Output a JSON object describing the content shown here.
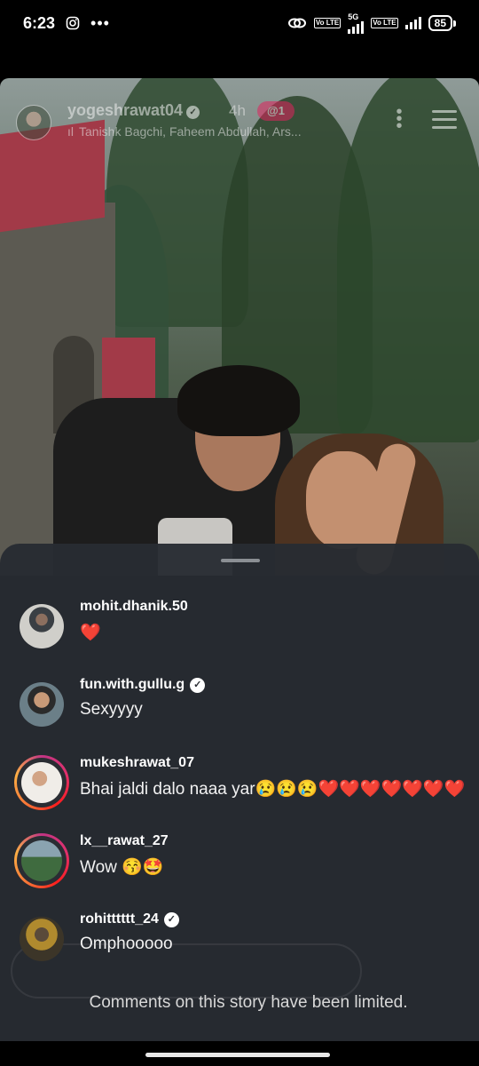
{
  "status_bar": {
    "time": "6:23",
    "net_5g": "5G",
    "volte_label": "Vo LTE",
    "battery": "85"
  },
  "story": {
    "username": "yogeshrawat04",
    "time_ago": "4h",
    "close_friends_badge": "@1",
    "music": "Tanishk Bagchi, Faheem Abdullah, Ars..."
  },
  "comments": [
    {
      "username": "mohit.dhanik.50",
      "verified": false,
      "text": "❤️",
      "ring": false
    },
    {
      "username": "fun.with.gullu.g",
      "verified": true,
      "text": "Sexyyyy",
      "ring": false
    },
    {
      "username": "mukeshrawat_07",
      "verified": false,
      "text": "Bhai jaldi dalo naaa yar😢😢😢❤️❤️❤️❤️❤️❤️❤️",
      "ring": true
    },
    {
      "username": "lx__rawat_27",
      "verified": false,
      "text": "Wow 😚🤩",
      "ring": true
    },
    {
      "username": "rohitttttt_24",
      "verified": true,
      "text": "Omphooooo",
      "ring": false
    }
  ],
  "comments_limited_notice": "Comments on this story have been limited.",
  "colors": {
    "sheet_bg": "#282c32",
    "close_friends": "#e0245e",
    "heart": "#e0245e"
  },
  "icons": [
    "instagram-icon",
    "more-dots-icon",
    "link-icon",
    "signal-icon",
    "battery-icon",
    "verified-icon",
    "music-icon",
    "list-icon"
  ]
}
